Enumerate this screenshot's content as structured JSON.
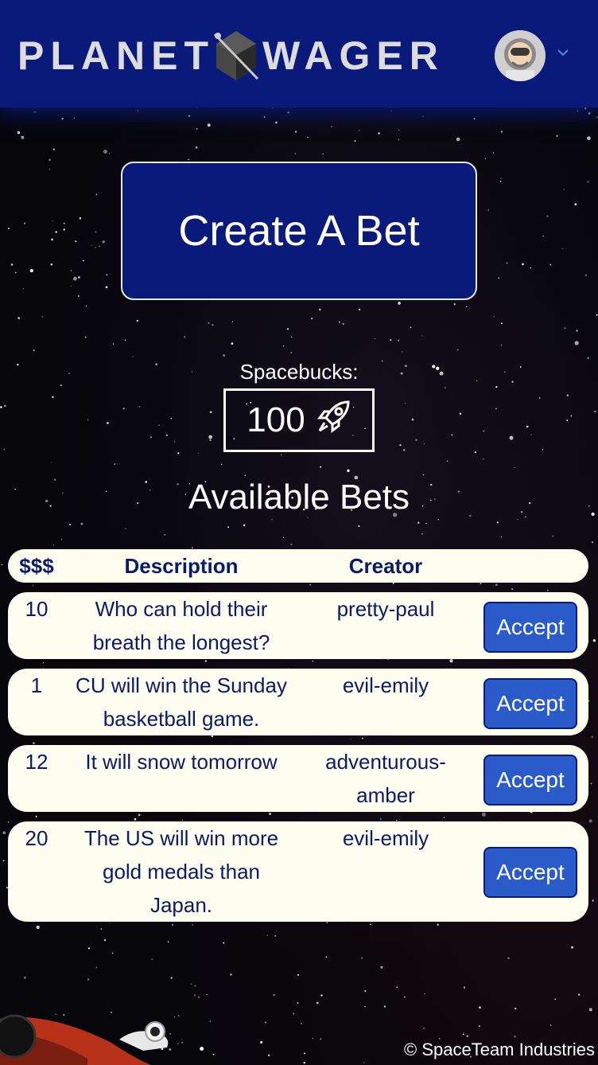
{
  "header": {
    "brand_left": "PLANET",
    "brand_right": "WAGER",
    "avatar_icon": "astronaut-avatar-icon",
    "menu_icon": "chevron-down-icon"
  },
  "main": {
    "create_bet_label": "Create A Bet",
    "spacebucks_label": "Spacebucks:",
    "spacebucks_value": "100",
    "spacebucks_icon": "rocket-icon",
    "available_title": "Available Bets"
  },
  "table": {
    "headers": [
      "$$$",
      "Description",
      "Creator"
    ],
    "rows": [
      {
        "amount": "10",
        "description": [
          "Who can hold their",
          "breath the longest?"
        ],
        "creator": [
          "pretty-paul"
        ],
        "action": "Accept"
      },
      {
        "amount": "1",
        "description": [
          "CU will win the Sunday",
          "basketball game."
        ],
        "creator": [
          "evil-emily"
        ],
        "action": "Accept"
      },
      {
        "amount": "12",
        "description": [
          "It will snow tomorrow"
        ],
        "creator": [
          "adventurous-",
          "amber"
        ],
        "action": "Accept"
      },
      {
        "amount": "20",
        "description": [
          "The US will win more",
          "gold medals than",
          "Japan."
        ],
        "creator": [
          "evil-emily"
        ],
        "action": "Accept"
      }
    ]
  },
  "footer": {
    "copyright": "© SpaceTeam Industries"
  },
  "colors": {
    "header_bg": "#0a1a7a",
    "row_bg": "#fdfdf0",
    "accept_bg": "#2a5bc8",
    "text_dark": "#0a1a6a"
  }
}
